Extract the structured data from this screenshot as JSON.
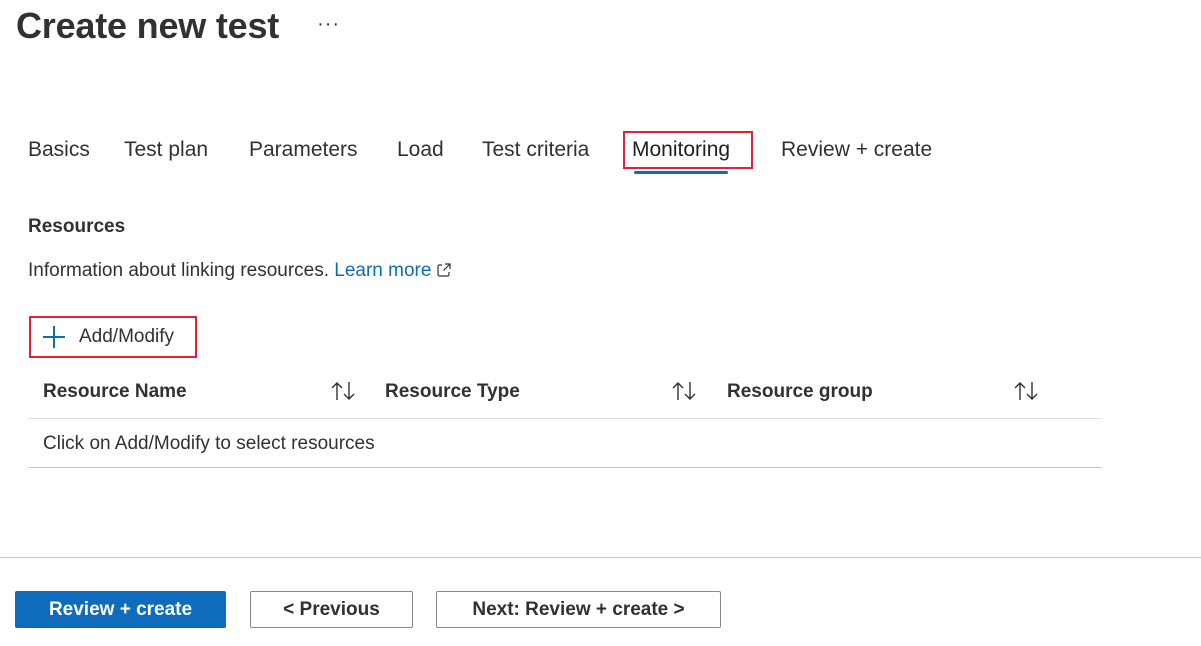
{
  "page": {
    "title": "Create new test",
    "more_label": "···"
  },
  "tabs": [
    {
      "label": "Basics"
    },
    {
      "label": "Test plan"
    },
    {
      "label": "Parameters"
    },
    {
      "label": "Load"
    },
    {
      "label": "Test criteria"
    },
    {
      "label": "Monitoring",
      "selected": true
    },
    {
      "label": "Review + create"
    }
  ],
  "resources": {
    "section_title": "Resources",
    "info_text": "Information about linking resources.",
    "learn_more": "Learn more",
    "add_modify_label": "Add/Modify"
  },
  "grid": {
    "columns": [
      {
        "label": "Resource Name"
      },
      {
        "label": "Resource Type"
      },
      {
        "label": "Resource group"
      }
    ],
    "empty_message": "Click on Add/Modify to select resources"
  },
  "footer": {
    "review_create": "Review + create",
    "previous": "< Previous",
    "next": "Next: Review + create >"
  },
  "colors": {
    "accent": "#0f6cbd",
    "highlight": "#e0213b",
    "text": "#323130"
  },
  "icons": {
    "more": "ellipsis-icon",
    "external": "external-link-icon",
    "add": "plus-icon",
    "sort": "sort-arrows-icon"
  }
}
